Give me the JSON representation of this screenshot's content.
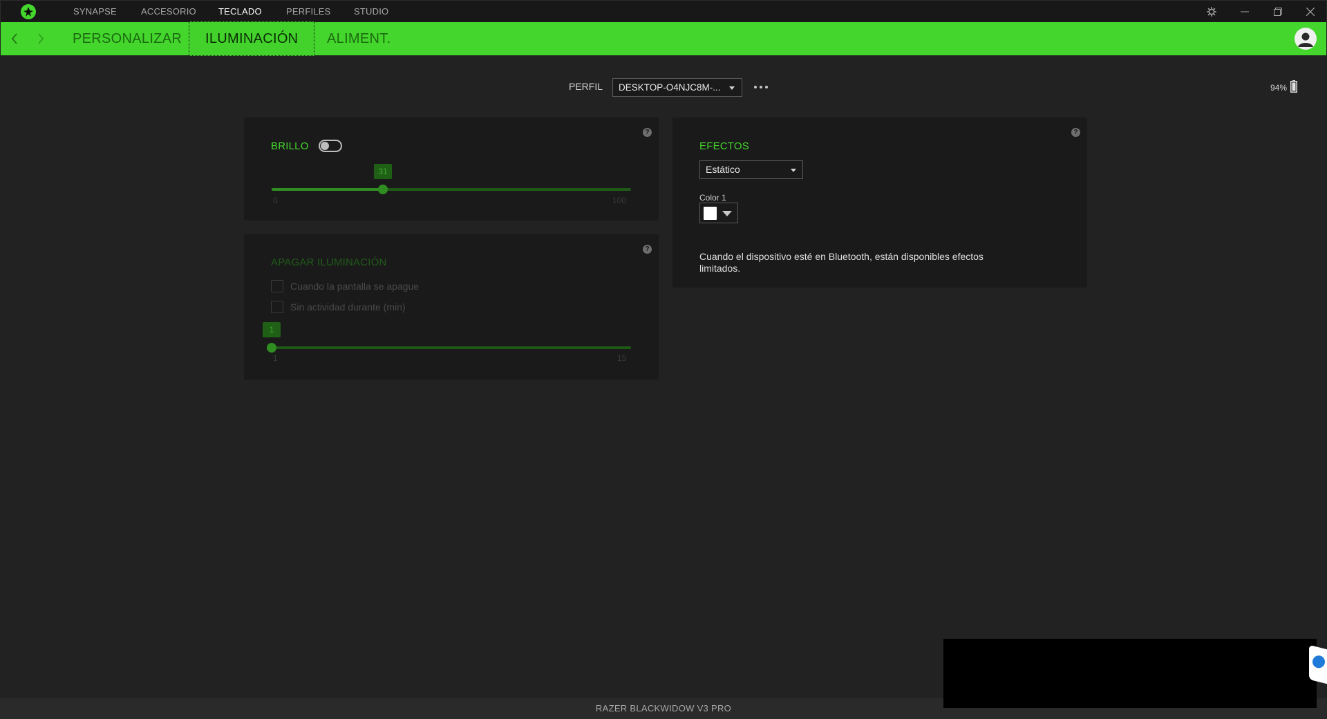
{
  "app": {
    "top_nav": [
      "SYNAPSE",
      "ACCESORIO",
      "TECLADO",
      "PERFILES",
      "STUDIO"
    ],
    "active_top_nav": "TECLADO",
    "icons": [
      "razer-logo-icon",
      "settings-gear-icon",
      "minimize-icon",
      "restore-icon",
      "close-icon"
    ]
  },
  "sub_nav": {
    "tabs": [
      "PERSONALIZAR",
      "ILUMINACIÓN",
      "ALIMENT."
    ],
    "active_tab": "ILUMINACIÓN",
    "accent_color": "#44d62c"
  },
  "profile": {
    "label": "PERFIL",
    "selected": "DESKTOP-O4NJC8M-...",
    "more_icon": "ellipsis-icon"
  },
  "battery": {
    "text": "94%",
    "icon": "battery-icon"
  },
  "brightness_panel": {
    "title": "BRILLO",
    "toggle_on": false,
    "slider": {
      "value": 31,
      "min": 0,
      "max": 100,
      "min_label": "0",
      "max_label": "100",
      "value_label": "31"
    },
    "help_icon": "help-icon"
  },
  "lighting_off_panel": {
    "title": "APAGAR ILUMINACIÓN",
    "options": [
      {
        "label": "Cuando la pantalla se apague",
        "checked": false
      },
      {
        "label": "Sin actividad durante (min)",
        "checked": false
      }
    ],
    "slider": {
      "value": 1,
      "min": 1,
      "max": 15,
      "min_label": "1",
      "max_label": "15",
      "value_label": "1"
    },
    "help_icon": "help-icon"
  },
  "effects_panel": {
    "title": "EFECTOS",
    "selected_effect": "Estático",
    "color_label": "Color 1",
    "color_value": "#ffffff",
    "note": "Cuando el dispositivo esté en Bluetooth, están disponibles efectos limitados.",
    "help_icon": "help-icon"
  },
  "footer": {
    "device_name": "RAZER BLACKWIDOW V3 PRO"
  }
}
